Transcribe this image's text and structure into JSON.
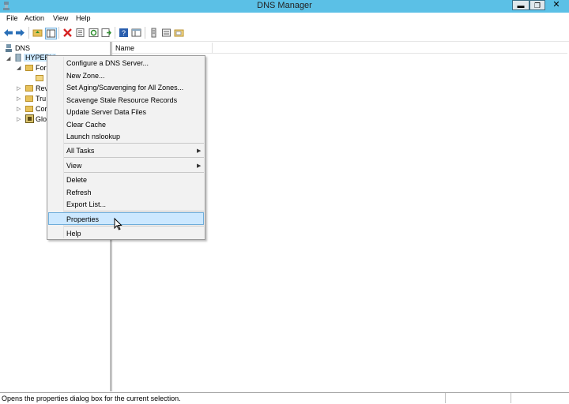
{
  "window": {
    "title": "DNS Manager"
  },
  "window_controls": {
    "minimize": "▬",
    "restore": "❐",
    "close": "✕"
  },
  "menu": [
    "File",
    "Action",
    "View",
    "Help"
  ],
  "toolbar": {
    "icons": [
      "back-arrow-icon",
      "forward-arrow-icon",
      "folder-up-icon",
      "show-hide-console-tree-icon",
      "delete-icon",
      "properties-icon",
      "refresh-icon",
      "export-list-icon",
      "help-icon",
      "console-pane-icon",
      "record-icon",
      "server-icon",
      "folder-icon"
    ]
  },
  "tree": {
    "root": "DNS",
    "server": "HYPERV",
    "forward": "For",
    "reverse": "Rev",
    "trust": "Tru",
    "conditional": "Cor",
    "global": "Glo"
  },
  "list": {
    "column_name": "Name"
  },
  "context_menu": {
    "items": [
      "Configure a DNS Server...",
      "New Zone...",
      "Set Aging/Scavenging for All Zones...",
      "Scavenge Stale Resource Records",
      "Update Server Data Files",
      "Clear Cache",
      "Launch nslookup",
      "All Tasks",
      "View",
      "Delete",
      "Refresh",
      "Export List...",
      "Properties",
      "Help"
    ],
    "highlighted": "Properties"
  },
  "status": {
    "text": "Opens the properties dialog box for the current selection."
  },
  "colors": {
    "titlebar": "#5bc0e6",
    "highlight": "#cce8ff",
    "highlight_border": "#6eaddb"
  }
}
